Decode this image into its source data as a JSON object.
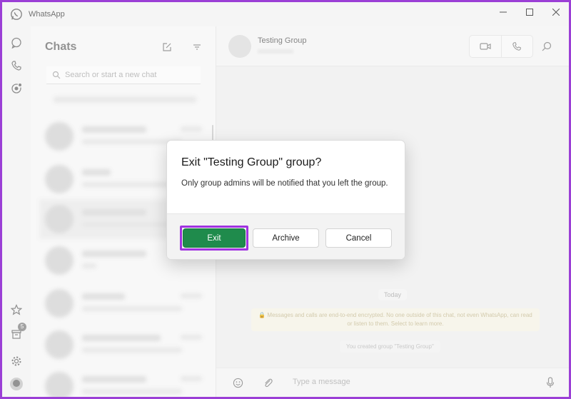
{
  "app": {
    "title": "WhatsApp"
  },
  "rail": {
    "archived_badge": "5"
  },
  "chats": {
    "title": "Chats",
    "search_placeholder": "Search or start a new chat"
  },
  "conversation": {
    "group_name": "Testing Group",
    "date_chip": "Today",
    "encryption_notice": "🔒 Messages and calls are end-to-end encrypted. No one outside of this chat, not even WhatsApp, can read or listen to them. Select to learn more.",
    "created_notice": "You created group \"Testing Group\"",
    "message_placeholder": "Type a message"
  },
  "dialog": {
    "title": "Exit \"Testing Group\" group?",
    "body": "Only group admins will be notified that you left the group.",
    "exit_label": "Exit",
    "archive_label": "Archive",
    "cancel_label": "Cancel"
  },
  "colors": {
    "accent_green": "#1f8b4c",
    "highlight_purple": "#a033e0",
    "frame_purple": "#9b3fd6"
  },
  "icons": {
    "app_logo": "whatsapp-logo-icon",
    "chats": "chat-bubble-icon",
    "calls": "phone-icon",
    "status": "status-ring-icon",
    "starred": "star-icon",
    "archived": "archive-icon",
    "settings": "gear-icon",
    "new_chat": "compose-icon",
    "filter": "filter-icon",
    "video_call": "video-camera-icon",
    "voice_call": "phone-icon",
    "search": "search-icon",
    "emoji": "emoji-icon",
    "attach": "paperclip-icon",
    "mic": "microphone-icon"
  }
}
